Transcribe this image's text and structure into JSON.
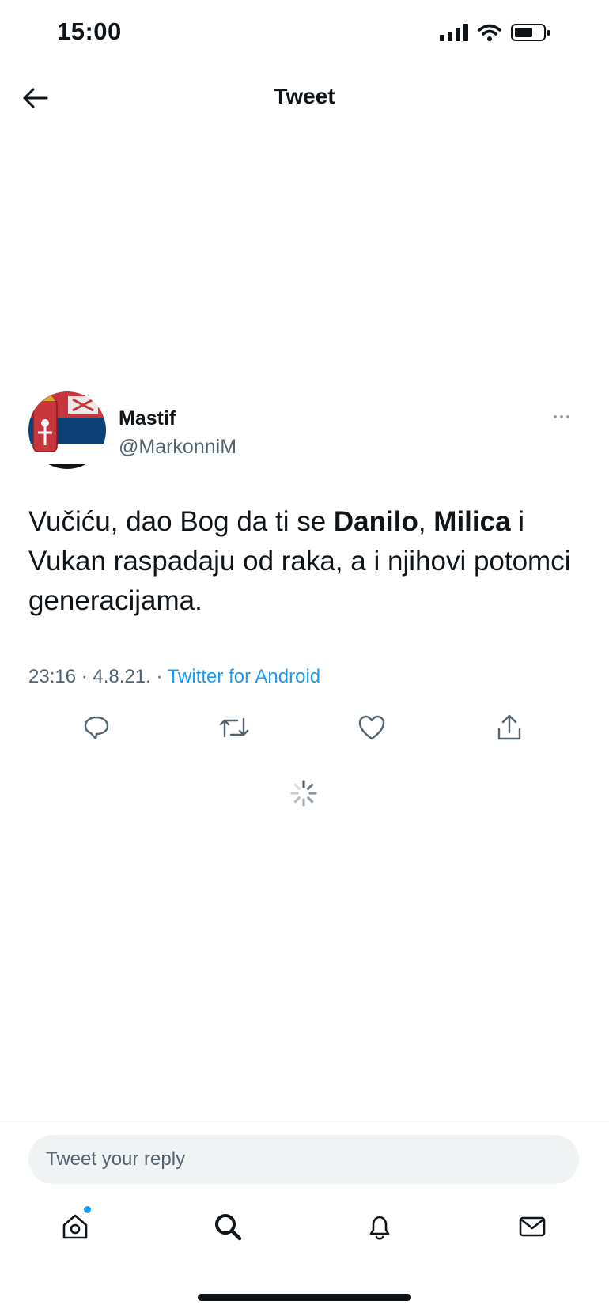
{
  "status_bar": {
    "time": "15:00"
  },
  "header": {
    "title": "Tweet"
  },
  "tweet": {
    "author_name": "Mastif",
    "author_handle": "@MarkonniM",
    "text_parts": {
      "p1": "Vučiću, dao Bog da ti se ",
      "b1": "Danilo",
      "p2": ", ",
      "b2": "Milica",
      "p3": " i Vukan raspadaju od raka, a i njihovi potomci generacijama."
    },
    "time": "23:16",
    "date": "4.8.21.",
    "separator": "·",
    "source": "Twitter for Android"
  },
  "reply": {
    "placeholder": "Tweet your reply"
  },
  "colors": {
    "accent": "#1d9bf0",
    "text": "#0f1419",
    "secondary": "#536471",
    "input_bg": "#eff3f4"
  },
  "icons": [
    "back-arrow",
    "more-dots",
    "reply",
    "retweet",
    "like",
    "share",
    "spinner",
    "home",
    "search",
    "notifications",
    "messages"
  ]
}
